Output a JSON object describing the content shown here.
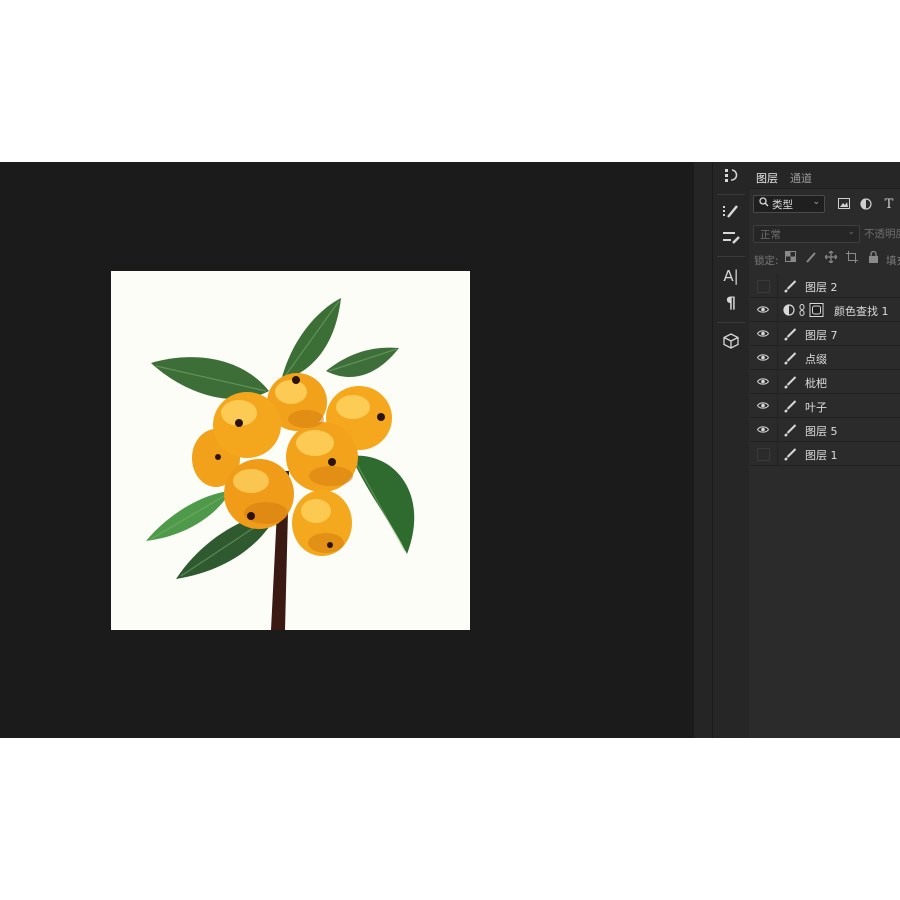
{
  "panel": {
    "tabs": [
      {
        "label": "图层",
        "active": true
      },
      {
        "label": "通道",
        "active": false
      }
    ],
    "filter": {
      "kind_label": "类型",
      "icons": [
        "search-icon",
        "image-filter-icon",
        "adjustment-filter-icon",
        "type-filter-icon"
      ],
      "type_glyph": "T"
    },
    "blend_mode": "正常",
    "opacity_label": "不透明度",
    "lock": {
      "label": "锁定:",
      "icons": [
        "lock-transparent-icon",
        "lock-pixels-icon",
        "lock-position-icon",
        "lock-artboard-icon",
        "lock-all-icon"
      ],
      "fill_label": "填充"
    },
    "layers": [
      {
        "name": "图层 2",
        "visible": false,
        "type": "pixel"
      },
      {
        "name": "颜色查找 1",
        "visible": true,
        "type": "adjustment"
      },
      {
        "name": "图层 7",
        "visible": true,
        "type": "pixel"
      },
      {
        "name": "点缀",
        "visible": true,
        "type": "pixel"
      },
      {
        "name": "枇杷",
        "visible": true,
        "type": "pixel"
      },
      {
        "name": "叶子",
        "visible": true,
        "type": "pixel"
      },
      {
        "name": "图层 5",
        "visible": true,
        "type": "pixel"
      },
      {
        "name": "图层 1",
        "visible": false,
        "type": "pixel"
      }
    ]
  },
  "tools": {
    "icons": [
      "history-icon",
      "brush-settings-icon",
      "tool-presets-icon",
      "character-icon",
      "paragraph-icon",
      "3d-icon"
    ],
    "character_glyph": "A|",
    "paragraph_glyph": "¶"
  },
  "artwork": {
    "subject": "loquat branch illustration",
    "colors": {
      "background": "#fdfdf8",
      "fruit": "#f4a51c",
      "fruit_shadow": "#d67d10",
      "fruit_highlight": "#ffd463",
      "leaf": "#3f7a3a",
      "leaf_dark": "#2c5a2e",
      "stem": "#3a1a12"
    }
  },
  "theme": {
    "app_bg": "#1c1c1c",
    "panel_bg": "#2b2b2b",
    "text": "#dcdcdc"
  }
}
